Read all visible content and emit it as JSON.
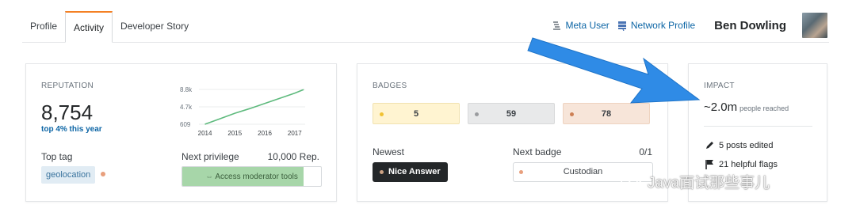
{
  "tabs": [
    {
      "label": "Profile",
      "active": false
    },
    {
      "label": "Activity",
      "active": true
    },
    {
      "label": "Developer Story",
      "active": false
    }
  ],
  "header": {
    "meta_user": "Meta User",
    "network_profile": "Network Profile",
    "username": "Ben Dowling"
  },
  "reputation": {
    "title": "REPUTATION",
    "value": "8,754",
    "rank": "top 4% this year",
    "chart_data": {
      "type": "line",
      "x_ticks": [
        "2014",
        "2015",
        "2016",
        "2017"
      ],
      "y_ticks": [
        "8.8k",
        "4.7k",
        "609"
      ],
      "ylim": [
        609,
        8800
      ],
      "x": [
        2014.0,
        2014.5,
        2015.0,
        2015.5,
        2016.0,
        2016.5,
        2017.0,
        2017.3
      ],
      "values": [
        609,
        1900,
        3200,
        4300,
        5500,
        6700,
        7900,
        8754
      ],
      "color": "#5eba7d"
    },
    "top_tag_label": "Top tag",
    "top_tag": "geolocation",
    "next_privilege_label": "Next privilege",
    "next_privilege_rep": "10,000 Rep.",
    "privilege_name": "Access moderator tools",
    "privilege_progress": 0.875
  },
  "badges": {
    "title": "BADGES",
    "gold": "5",
    "silver": "59",
    "bronze": "78",
    "newest_label": "Newest",
    "newest_badge": "Nice Answer",
    "next_badge_label": "Next badge",
    "next_badge_count": "0/1",
    "next_badge": "Custodian"
  },
  "impact": {
    "title": "IMPACT",
    "reach_value": "~2.0m",
    "reach_label": "people reached",
    "posts_edited": "5 posts edited",
    "helpful_flags": "21 helpful flags"
  },
  "watermark": "Java面试那些事儿",
  "colors": {
    "link": "#0c65a5",
    "accent": "#f48024",
    "arrow": "#2f8be6"
  }
}
